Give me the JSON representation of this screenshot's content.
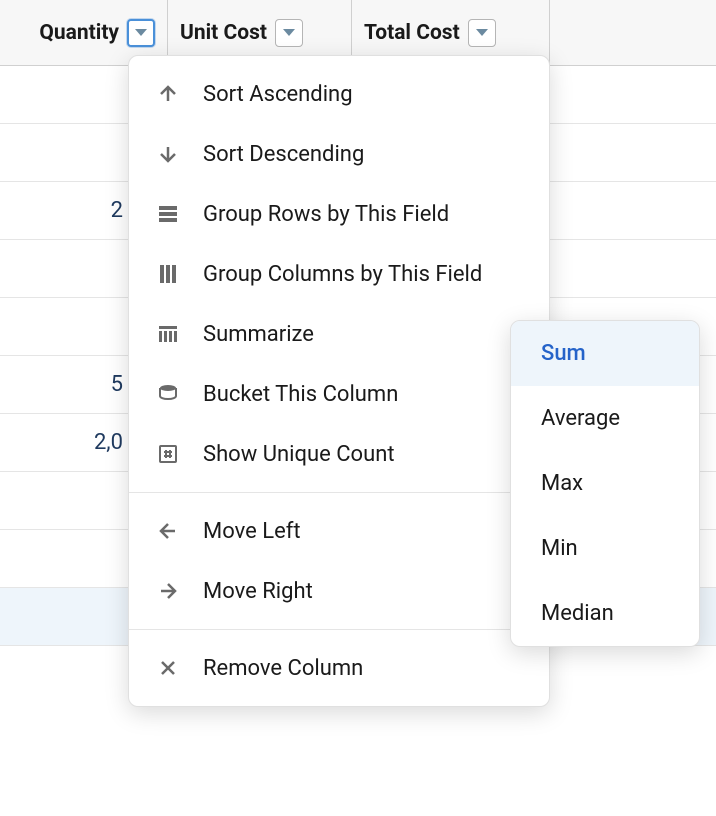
{
  "columns": {
    "quantity": {
      "label": "Quantity"
    },
    "unit_cost": {
      "label": "Unit Cost"
    },
    "total_cost": {
      "label": "Total Cost"
    }
  },
  "rows": {
    "r2": "2",
    "r5": "5",
    "r6": "2,0"
  },
  "menu": {
    "sort_asc": "Sort Ascending",
    "sort_desc": "Sort Descending",
    "group_rows": "Group Rows by This Field",
    "group_cols": "Group Columns by This Field",
    "summarize": "Summarize",
    "bucket": "Bucket This Column",
    "unique_count": "Show Unique Count",
    "move_left": "Move Left",
    "move_right": "Move Right",
    "remove": "Remove Column"
  },
  "submenu": {
    "sum": "Sum",
    "average": "Average",
    "max": "Max",
    "min": "Min",
    "median": "Median"
  }
}
